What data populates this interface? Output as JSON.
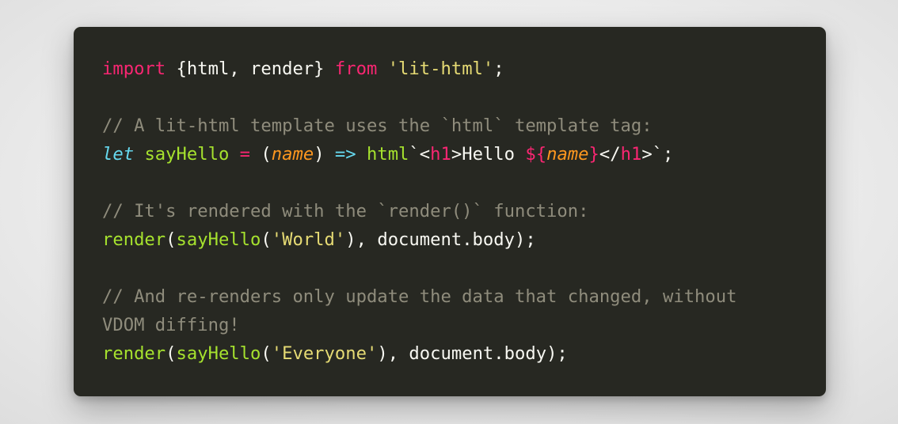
{
  "colors": {
    "background": "#272822",
    "keyword": "#f92672",
    "plain": "#f8f8f2",
    "string": "#e6db74",
    "comment": "#8f8c7c",
    "storage": "#66d9ef",
    "function": "#a6e22e",
    "parameter": "#fd971f"
  },
  "code": {
    "lines": [
      [
        {
          "t": "keyword",
          "v": "import"
        },
        {
          "t": "plain",
          "v": " {html, render} "
        },
        {
          "t": "keyword",
          "v": "from"
        },
        {
          "t": "plain",
          "v": " "
        },
        {
          "t": "string",
          "v": "'lit-html'"
        },
        {
          "t": "plain",
          "v": ";"
        }
      ],
      [],
      [
        {
          "t": "comment",
          "v": "// A lit-html template uses the `html` template tag:"
        }
      ],
      [
        {
          "t": "storage",
          "v": "let"
        },
        {
          "t": "plain",
          "v": " "
        },
        {
          "t": "func",
          "v": "sayHello"
        },
        {
          "t": "plain",
          "v": " "
        },
        {
          "t": "keyword",
          "v": "="
        },
        {
          "t": "plain",
          "v": " ("
        },
        {
          "t": "param",
          "v": "name"
        },
        {
          "t": "plain",
          "v": ") "
        },
        {
          "t": "storage",
          "v": "=>"
        },
        {
          "t": "plain",
          "v": " "
        },
        {
          "t": "func",
          "v": "html"
        },
        {
          "t": "plain",
          "v": "`<"
        },
        {
          "t": "tag",
          "v": "h1"
        },
        {
          "t": "plain",
          "v": ">Hello "
        },
        {
          "t": "keyword",
          "v": "${"
        },
        {
          "t": "param",
          "v": "name"
        },
        {
          "t": "keyword",
          "v": "}"
        },
        {
          "t": "plain",
          "v": "</"
        },
        {
          "t": "tag",
          "v": "h1"
        },
        {
          "t": "plain",
          "v": ">`;"
        }
      ],
      [],
      [
        {
          "t": "comment",
          "v": "// It's rendered with the `render()` function:"
        }
      ],
      [
        {
          "t": "func",
          "v": "render"
        },
        {
          "t": "plain",
          "v": "("
        },
        {
          "t": "func",
          "v": "sayHello"
        },
        {
          "t": "plain",
          "v": "("
        },
        {
          "t": "string",
          "v": "'World'"
        },
        {
          "t": "plain",
          "v": "), document.body);"
        }
      ],
      [],
      [
        {
          "t": "comment",
          "v": "// And re-renders only update the data that changed, without"
        }
      ],
      [
        {
          "t": "comment",
          "v": "VDOM diffing!"
        }
      ],
      [
        {
          "t": "func",
          "v": "render"
        },
        {
          "t": "plain",
          "v": "("
        },
        {
          "t": "func",
          "v": "sayHello"
        },
        {
          "t": "plain",
          "v": "("
        },
        {
          "t": "string",
          "v": "'Everyone'"
        },
        {
          "t": "plain",
          "v": "), document.body);"
        }
      ]
    ]
  }
}
